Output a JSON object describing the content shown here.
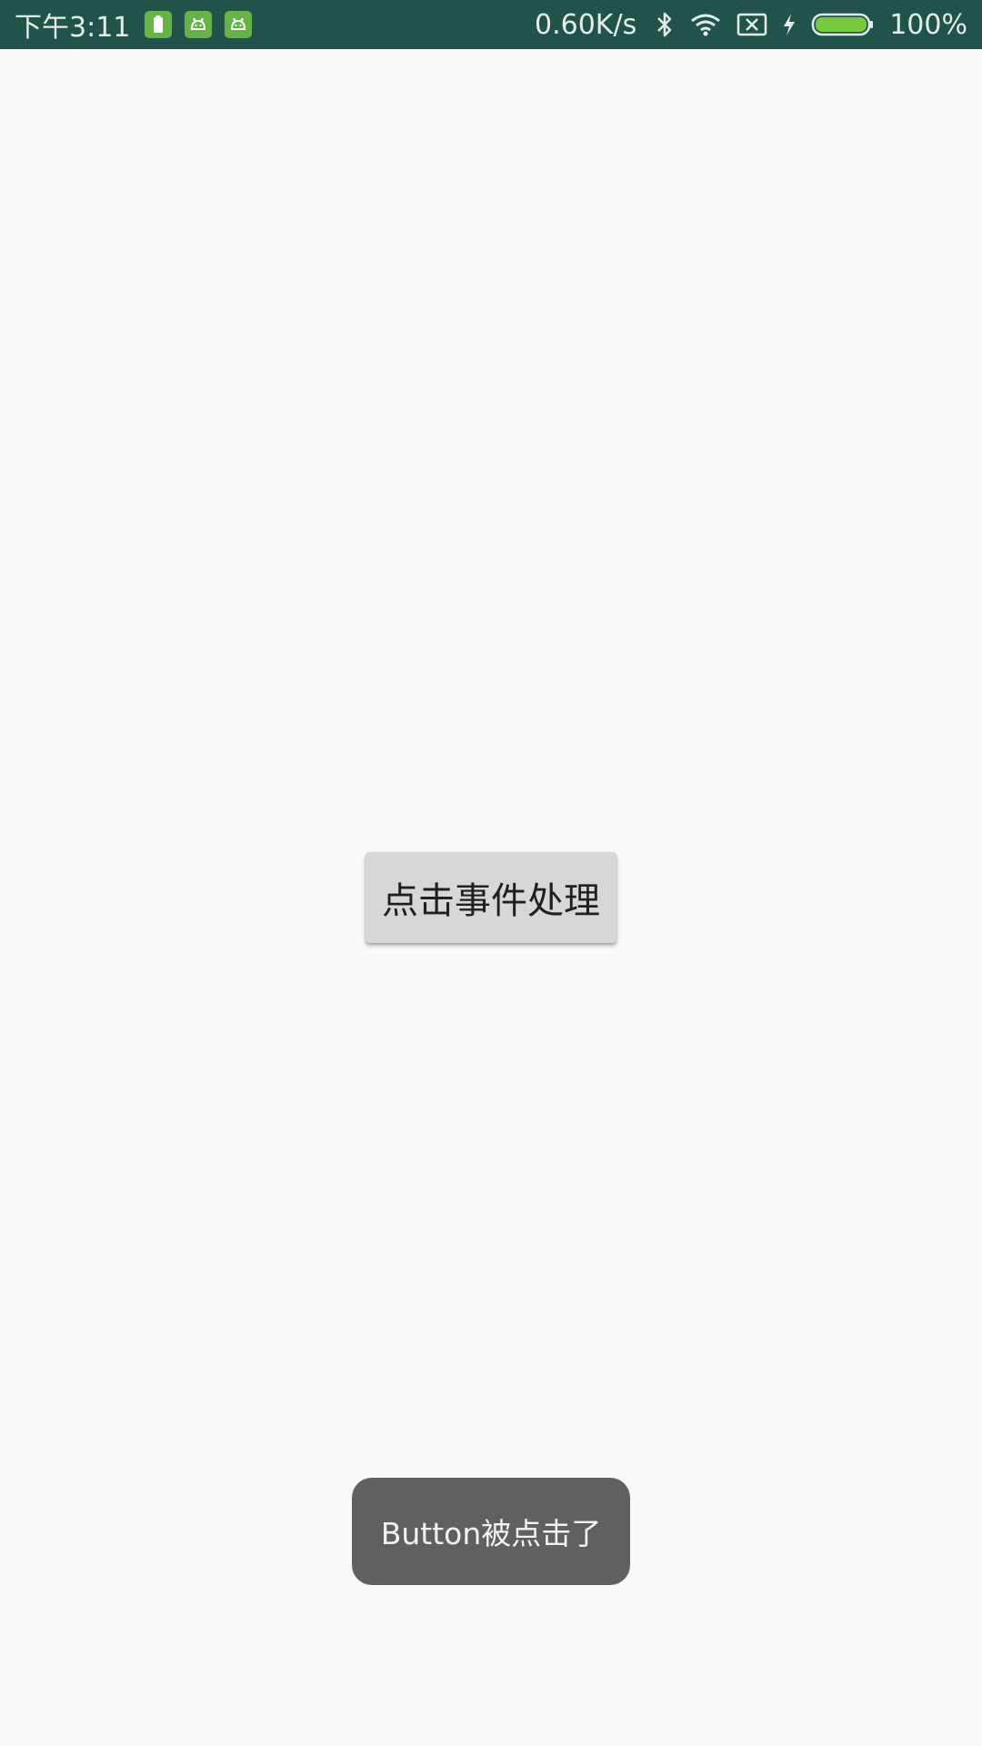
{
  "status_bar": {
    "time": "下午3:11",
    "network_speed": "0.60K/s",
    "battery_percent": "100%",
    "battery_level": 1.0,
    "colors": {
      "background": "#21534a",
      "notification_icon_bg": "#66b34a",
      "battery_fill": "#7ac943"
    },
    "notification_icons": [
      "battery-notification-icon",
      "android-notification-icon",
      "android-notification-icon"
    ],
    "system_icons": [
      "bluetooth-icon",
      "wifi-icon",
      "no-sim-icon",
      "charging-bolt-icon",
      "battery-icon"
    ]
  },
  "main": {
    "button_label": "点击事件处理"
  },
  "toast": {
    "message": "Button被点击了"
  }
}
